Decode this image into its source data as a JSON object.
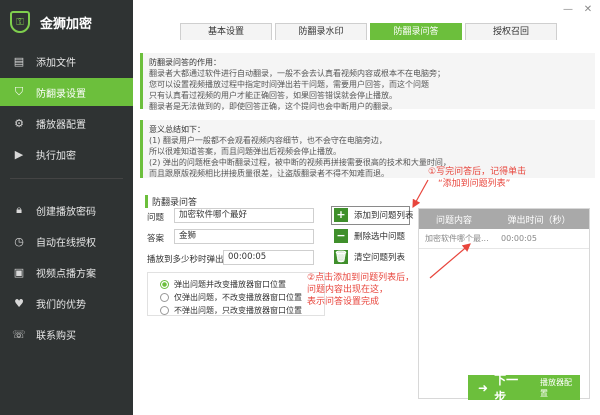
{
  "app": {
    "title": "金狮加密"
  },
  "sidebar": {
    "items": [
      {
        "label": "添加文件",
        "icon": "file-plus-icon"
      },
      {
        "label": "防翻录设置",
        "icon": "shield-icon",
        "active": true
      },
      {
        "label": "播放器配置",
        "icon": "gear-icon"
      },
      {
        "label": "执行加密",
        "icon": "play-icon"
      },
      {
        "label": "创建播放密码",
        "icon": "lock-icon"
      },
      {
        "label": "自动在线授权",
        "icon": "clock-icon"
      },
      {
        "label": "视频点播方案",
        "icon": "video-icon"
      },
      {
        "label": "我们的优势",
        "icon": "heart-icon"
      },
      {
        "label": "联系购买",
        "icon": "contact-icon"
      }
    ]
  },
  "tabs": [
    {
      "label": "基本设置"
    },
    {
      "label": "防翻录水印"
    },
    {
      "label": "防翻录问答",
      "active": true
    },
    {
      "label": "授权召回"
    }
  ],
  "purpose": {
    "heading": "防翻录问答的作用：",
    "lines": [
      "翻录者大都通过软件进行自动翻录，一般不会去认真看视频内容或根本不在电脑旁；",
      "您可以设置视频播放过程中指定时间弹出若干问题，需要用户回答，而这个问题",
      "只有认真看过视频的用户才能正确回答，如果回答错误就会停止播放。",
      "翻录者是无法做到的，即使回答正确，这个提问也会中断用户的翻录。"
    ]
  },
  "summary": {
    "heading": "意义总结如下：",
    "lines": [
      "(1) 翻录用户一般都不会观看视频内容细节，也不会守在电脑旁边，",
      "所以很难知道答案，而且问题弹出后视频会停止播放。",
      "(2) 弹出的问题框会中断翻录过程，被中断的视频再拼接需要很高的技术和大量时间，",
      "而且跟原版视频相比拼接质量很差，让盗版翻录者不得不知难而退。"
    ]
  },
  "qa": {
    "heading": "防翻录问答",
    "question_label": "问题",
    "question_value": "加密软件哪个最好",
    "answer_label": "答案",
    "answer_value": "金狮",
    "time_label": "播放到多少秒时弹出",
    "time_value": "00:00:05",
    "add_label": "添加到问题列表",
    "delete_label": "删除选中问题",
    "clear_label": "清空问题列表",
    "options": [
      "弹出问题并改变播放器窗口位置",
      "仅弹出问题，不改变播放器窗口位置",
      "不弹出问题，只改变播放器窗口位置"
    ]
  },
  "table": {
    "col1": "问题内容",
    "col2": "弹出时间（秒）",
    "rows": [
      {
        "question": "加密软件哪个最...",
        "time": "00:00:05"
      }
    ]
  },
  "annotations": {
    "a1_line1": "①写完问答后，记得单击",
    "a1_line2": "“添加到问题列表”",
    "a2_line1": "②点击添加到问题列表后，",
    "a2_line2": "问题内容出现在这，",
    "a2_line3": "表示问答设置完成",
    "color": "#e8453c"
  },
  "footer": {
    "next_arrow": "➜",
    "next_label": "下一步",
    "next_sub": "播放器配置"
  },
  "colors": {
    "accent": "#6cbf3c",
    "sidebar": "#2f3333"
  }
}
